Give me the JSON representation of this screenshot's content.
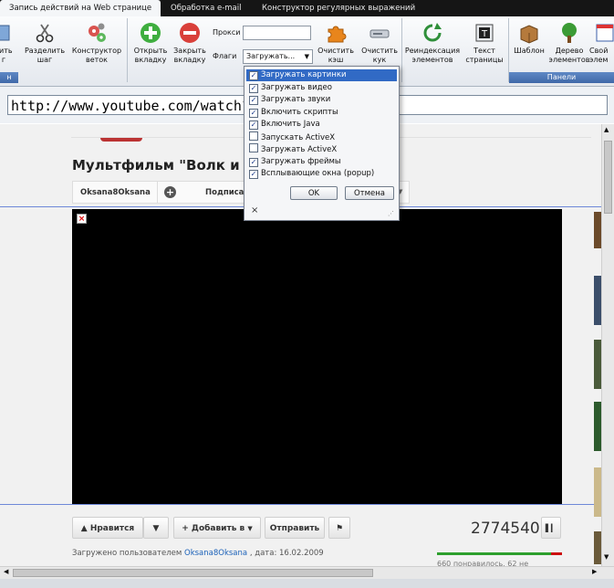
{
  "tabs": [
    {
      "label": "Запись действий на Web странице",
      "active": true
    },
    {
      "label": "Обработка e-mail",
      "active": false
    },
    {
      "label": "Конструктор регулярных выражений",
      "active": false
    }
  ],
  "ribbon": {
    "buttons": {
      "add_step": "вить\nг",
      "split_step": "Разделить\nшаг",
      "branch_builder": "Конструктор\nветок",
      "open_tab": "Открыть\nвкладку",
      "close_tab": "Закрыть\nвкладку",
      "clear_cache": "Очистить\nкэш",
      "clear_cookies": "Очистить\nкук",
      "reindex": "Реиндексация\nэлементов",
      "page_text": "Текст\nстраницы",
      "template": "Шаблон",
      "element_tree": "Дерево\nэлементов",
      "properties": "Свой\nэлем"
    },
    "proxy_label": "Прокси",
    "proxy_value": "",
    "flags_label": "Флаги",
    "flags_value": "Загружать...",
    "group_left": "н",
    "group_panels": "Панели"
  },
  "address_bar": {
    "url": "http://www.youtube.com/watch?v=eaT                                             &context=G26f2ac5RVAAAAAAAAg"
  },
  "flags_popup": {
    "options": [
      {
        "label": "Загружать картинки",
        "checked": true,
        "selected": true
      },
      {
        "label": "Загружать видео",
        "checked": true,
        "selected": false
      },
      {
        "label": "Загружать звуки",
        "checked": true,
        "selected": false
      },
      {
        "label": "Включить скрипты",
        "checked": true,
        "selected": false
      },
      {
        "label": "Включить Java",
        "checked": true,
        "selected": false
      },
      {
        "label": "Запускать ActiveX",
        "checked": false,
        "selected": false
      },
      {
        "label": "Загружать ActiveX",
        "checked": false,
        "selected": false
      },
      {
        "label": "Загружать фреймы",
        "checked": true,
        "selected": false
      },
      {
        "label": "Всплывающие окна (popup)",
        "checked": true,
        "selected": false
      }
    ],
    "ok_label": "OK",
    "cancel_label": "Отмена",
    "close_glyph": "×"
  },
  "page": {
    "video_title": "Мультфильм \"Волк и сем",
    "channel": "Oksana8Oksana",
    "subscribe": "Подписат",
    "like_label": "Нравится",
    "add_to_label": "Добавить в",
    "share_label": "Отправить",
    "views": "2774540",
    "uploaded_prefix": "Загружено пользователем",
    "uploaded_user": "Oksana8Oksana",
    "uploaded_date": ", дата: 16.02.2009",
    "likes_text": "660 понравилось, 62 не",
    "like_ratio": 0.91
  },
  "colors": {
    "selection": "#316ac5",
    "ribbon_group": "#4a74b6",
    "link": "#1c62b9"
  }
}
